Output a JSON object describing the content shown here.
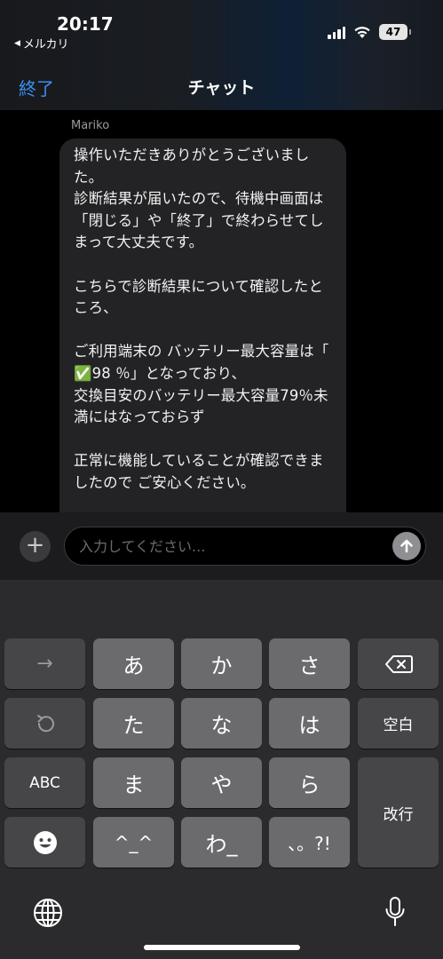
{
  "status_bar": {
    "time": "20:17",
    "back_app": "メルカリ",
    "battery": "47"
  },
  "nav": {
    "done_label": "終了",
    "title": "チャット"
  },
  "chat": {
    "sender": "Mariko",
    "message": "操作いただきありがとうございました。\n診断結果が届いたので、待機中画面は「閉じる」や「終了」で終わらせてしまって大丈夫です。\n\nこちらで診断結果について確認したところ、\n\nご利用端末の バッテリー最大容量は「 ✅98 ％」となっており、\n交換目安のバッテリー最大容量79％未満にはなっておらず\n\n正常に機能していることが確認できましたので ご安心ください。"
  },
  "input": {
    "placeholder": "入力してください...",
    "value": ""
  },
  "keyboard": {
    "arrow": "→",
    "a": "あ",
    "ka": "か",
    "sa": "さ",
    "delete_icon": "delete-icon",
    "undo_icon": "undo-icon",
    "ta": "た",
    "na": "な",
    "ha": "は",
    "space": "空白",
    "abc": "ABC",
    "ma": "ま",
    "ya": "や",
    "ra": "ら",
    "return": "改行",
    "emoji_icon": "emoji-icon",
    "kaomoji": "^_^",
    "wa": "わ_",
    "punct": "、。?!",
    "globe_icon": "globe-icon",
    "mic_icon": "microphone-icon"
  },
  "colors": {
    "accent": "#3b8ff3",
    "bubble": "#232325",
    "keyboard_bg": "#2b2b2d"
  }
}
